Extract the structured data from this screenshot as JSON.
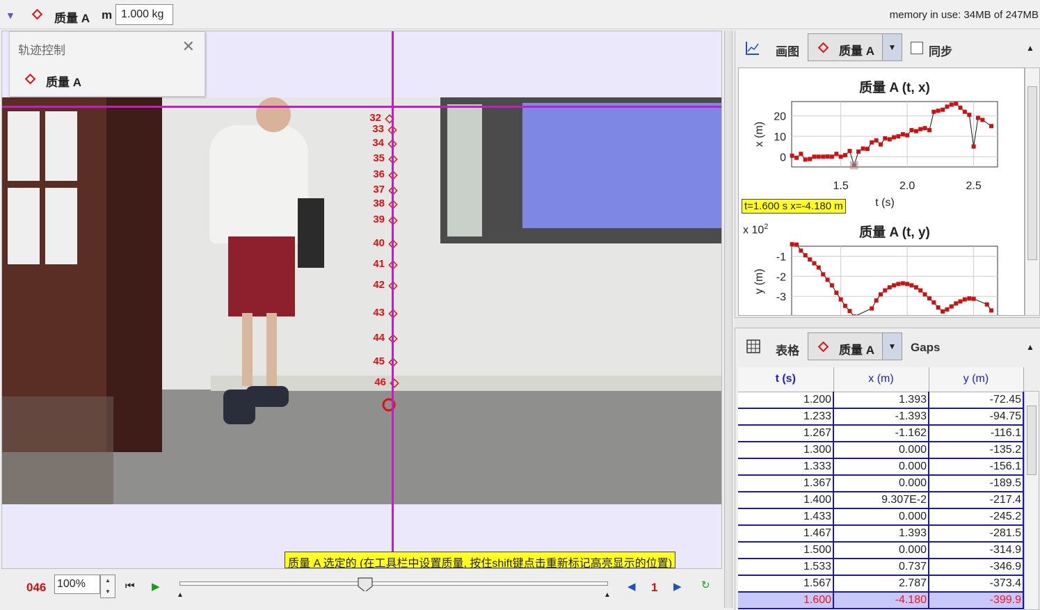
{
  "toolbar": {
    "mass_name": "质量 A",
    "mass_symbol": "m",
    "mass_value": "1.000 kg",
    "memory": "memory in use: 34MB of 247MB"
  },
  "track_control": {
    "title": "轨迹控制",
    "item": "质量 A"
  },
  "video": {
    "marker_labels": [
      "32",
      "33",
      "34",
      "35",
      "36",
      "37",
      "38",
      "39",
      "40",
      "41",
      "42",
      "43",
      "44",
      "45",
      "46"
    ],
    "status_message": "质量 A 选定的 (在工具栏中设置质量, 按住shift键点击重新标记高亮显示的位置)"
  },
  "player": {
    "frame": "046",
    "zoom": "100%",
    "step_size": "1"
  },
  "plot_panel": {
    "label": "画图",
    "track": "质量 A",
    "sync_label": "同步",
    "readout": "t=1.600 s  x=-4.180 m",
    "x10_label": "x 10",
    "x10_exp": "2"
  },
  "chart_data": [
    {
      "type": "line",
      "title": "质量 A (t, x)",
      "xlabel": "t (s)",
      "ylabel": "x (m)",
      "xlim": [
        1.13,
        2.68
      ],
      "ylim": [
        -5,
        27
      ],
      "xticks": [
        "1.5",
        "2.0",
        "2.5"
      ],
      "yticks": [
        "0",
        "10",
        "20"
      ],
      "x": [
        1.133,
        1.167,
        1.2,
        1.233,
        1.267,
        1.3,
        1.333,
        1.367,
        1.4,
        1.433,
        1.467,
        1.5,
        1.533,
        1.567,
        1.6,
        1.633,
        1.667,
        1.7,
        1.733,
        1.767,
        1.8,
        1.833,
        1.867,
        1.9,
        1.933,
        1.967,
        2.0,
        2.033,
        2.067,
        2.1,
        2.133,
        2.167,
        2.2,
        2.233,
        2.267,
        2.3,
        2.333,
        2.367,
        2.4,
        2.433,
        2.467,
        2.5,
        2.533,
        2.567,
        2.633
      ],
      "y": [
        0.5,
        -0.5,
        1.393,
        -1.393,
        -1.162,
        0.0,
        0.0,
        0.0,
        0.093,
        0.0,
        1.393,
        0.0,
        0.737,
        2.787,
        -4.18,
        2.5,
        4.0,
        3.8,
        7.0,
        8.0,
        6.0,
        9.0,
        8.5,
        9.5,
        10.0,
        11.0,
        10.5,
        13.0,
        12.5,
        13.5,
        14.0,
        13.0,
        22.0,
        22.5,
        23.0,
        24.5,
        25.5,
        26.0,
        24.0,
        22.0,
        20.5,
        5.0,
        19.0,
        18.0,
        15.0
      ]
    },
    {
      "type": "line",
      "title": "质量 A (t, y)",
      "xlabel": "",
      "ylabel": "y (m)",
      "xlim": [
        1.13,
        2.68
      ],
      "ylim": [
        -4.0,
        -0.5
      ],
      "yticks": [
        "-1",
        "-2",
        "-3"
      ],
      "x": [
        1.133,
        1.167,
        1.2,
        1.233,
        1.267,
        1.3,
        1.333,
        1.367,
        1.4,
        1.433,
        1.467,
        1.5,
        1.533,
        1.567,
        1.6,
        1.733,
        1.767,
        1.8,
        1.833,
        1.867,
        1.9,
        1.933,
        1.967,
        2.0,
        2.033,
        2.067,
        2.1,
        2.133,
        2.167,
        2.2,
        2.233,
        2.267,
        2.3,
        2.333,
        2.367,
        2.4,
        2.433,
        2.467,
        2.5,
        2.6,
        2.633
      ],
      "y": [
        -0.4,
        -0.42,
        -0.72,
        -0.95,
        -1.16,
        -1.35,
        -1.56,
        -1.9,
        -2.17,
        -2.45,
        -2.82,
        -3.15,
        -3.47,
        -3.73,
        -4.0,
        -3.6,
        -3.2,
        -2.9,
        -2.7,
        -2.55,
        -2.45,
        -2.38,
        -2.35,
        -2.38,
        -2.45,
        -2.55,
        -2.7,
        -2.9,
        -3.1,
        -3.3,
        -3.55,
        -3.75,
        -3.65,
        -3.5,
        -3.35,
        -3.25,
        -3.15,
        -3.1,
        -3.12,
        -3.4,
        -3.7
      ]
    }
  ],
  "table_panel": {
    "label": "表格",
    "track": "质量 A",
    "gaps": "Gaps",
    "columns": [
      "t (s)",
      "x (m)",
      "y (m)"
    ],
    "rows": [
      [
        "1.200",
        "1.393",
        "-72.45"
      ],
      [
        "1.233",
        "-1.393",
        "-94.75"
      ],
      [
        "1.267",
        "-1.162",
        "-116.1"
      ],
      [
        "1.300",
        "0.000",
        "-135.2"
      ],
      [
        "1.333",
        "0.000",
        "-156.1"
      ],
      [
        "1.367",
        "0.000",
        "-189.5"
      ],
      [
        "1.400",
        "9.307E-2",
        "-217.4"
      ],
      [
        "1.433",
        "0.000",
        "-245.2"
      ],
      [
        "1.467",
        "1.393",
        "-281.5"
      ],
      [
        "1.500",
        "0.000",
        "-314.9"
      ],
      [
        "1.533",
        "0.737",
        "-346.9"
      ],
      [
        "1.567",
        "2.787",
        "-373.4"
      ],
      [
        "1.600",
        "-4.180",
        "-399.9"
      ]
    ]
  }
}
